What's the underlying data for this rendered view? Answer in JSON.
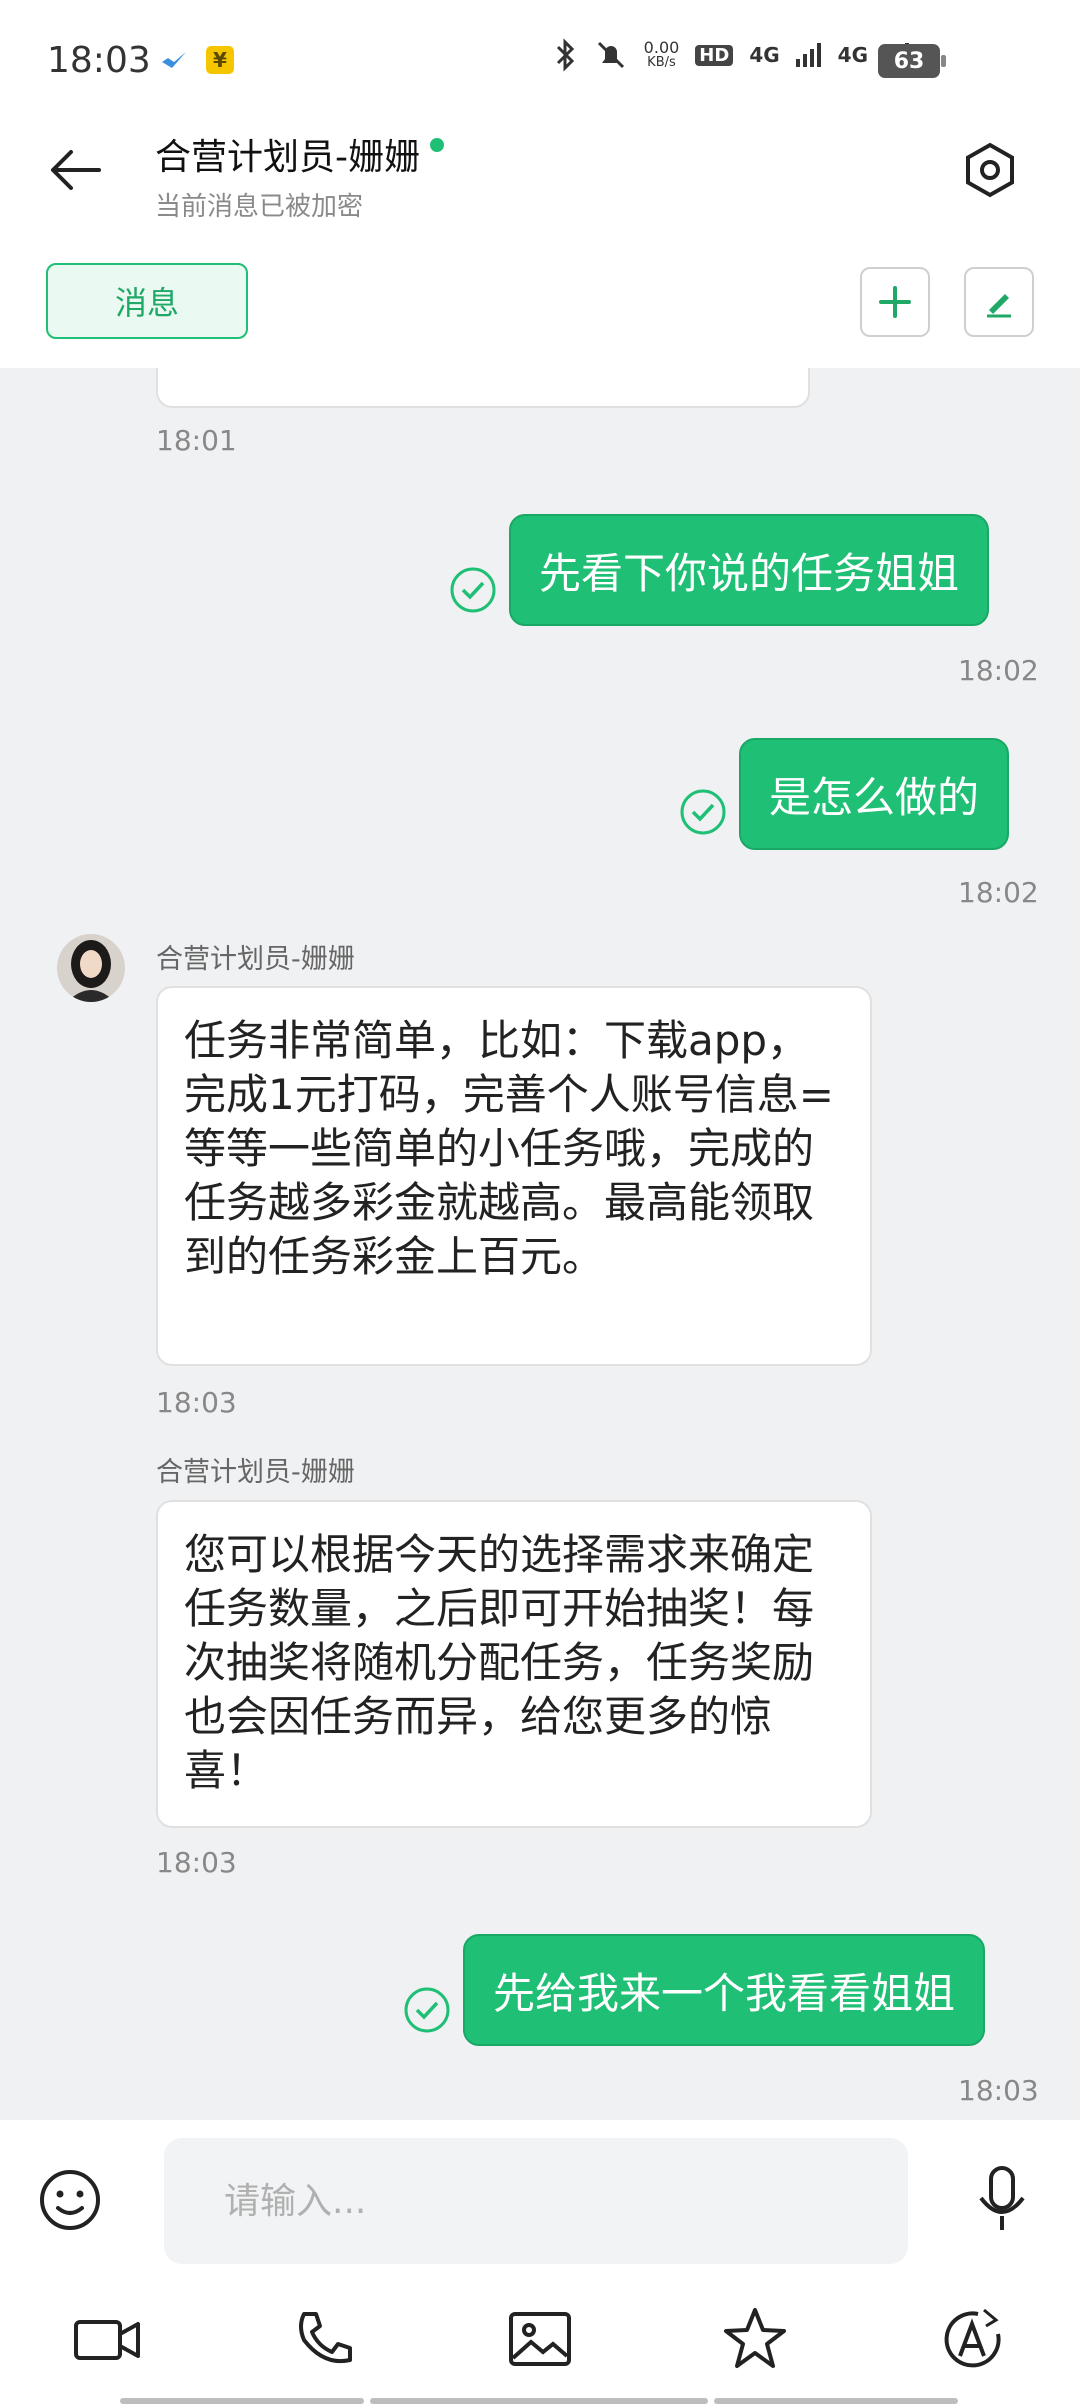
{
  "status_bar": {
    "time": "18:03",
    "speed_value": "0.00",
    "speed_unit": "KB/s",
    "hd": "HD",
    "net1": "4G",
    "net2": "4G",
    "battery": "63"
  },
  "header": {
    "title": "合营计划员-姗姗",
    "subtitle": "当前消息已被加密",
    "tab_label": "消息"
  },
  "messages": {
    "m0": {
      "time": "18:01"
    },
    "m1": {
      "text": "先看下你说的任务姐姐",
      "time": "18:02"
    },
    "m2": {
      "text": "是怎么做的",
      "time": "18:02"
    },
    "m3": {
      "sender": "合营计划员-姗姗",
      "text": "任务非常简单，比如：下载app，完成1元打码，完善个人账号信息=等等一些简单的小任务哦，完成的任务越多彩金就越高。最高能领取到的任务彩金上百元。",
      "time": "18:03"
    },
    "m4": {
      "sender": "合营计划员-姗姗",
      "text": "您可以根据今天的选择需求来确定任务数量，之后即可开始抽奖！每次抽奖将随机分配任务，任务奖励也会因任务而异，给您更多的惊喜！",
      "time": "18:03"
    },
    "m5": {
      "text": "先给我来一个我看看姐姐",
      "time": "18:03"
    }
  },
  "input": {
    "placeholder": "请输入..."
  },
  "colors": {
    "accent": "#1fbf75",
    "chat_bg": "#f0f1f3"
  }
}
